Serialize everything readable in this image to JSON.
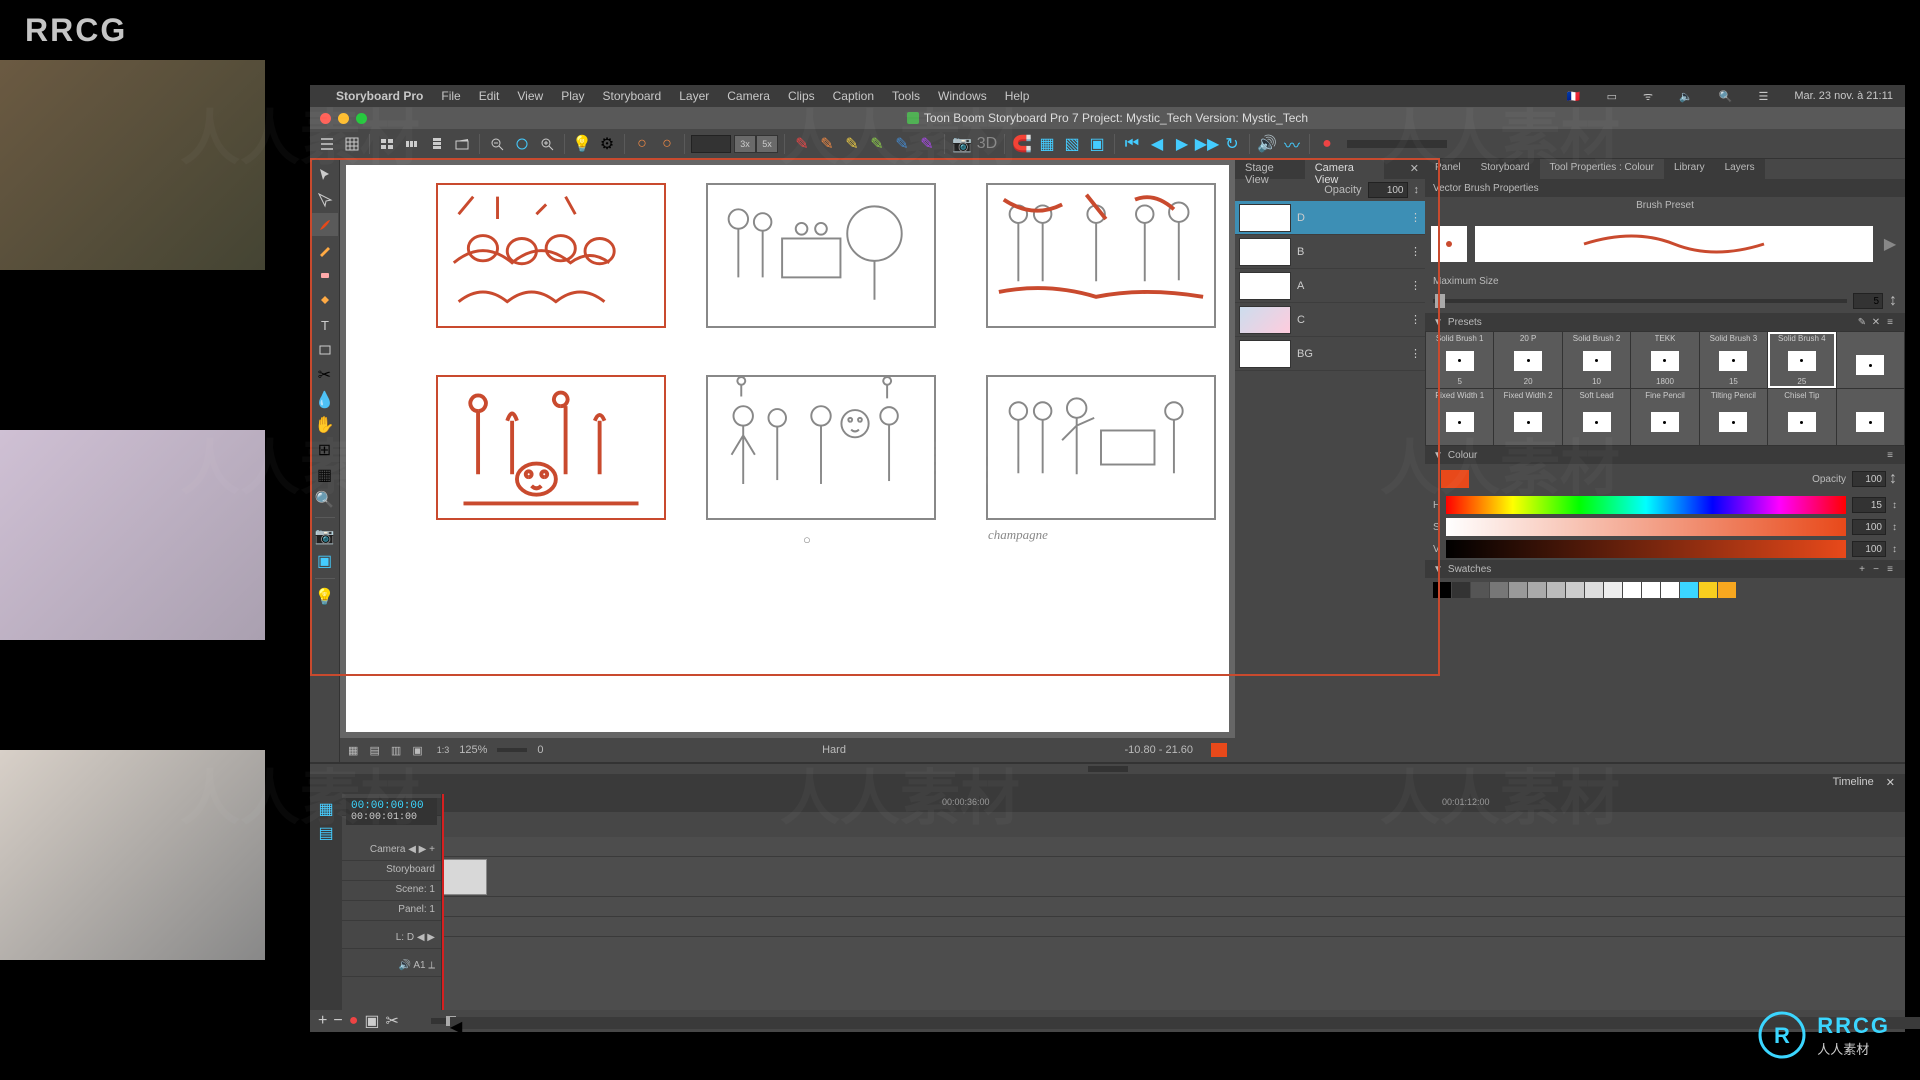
{
  "watermark_text": "RRCG",
  "menubar": {
    "apple": "",
    "app_name": "Storyboard Pro",
    "items": [
      "File",
      "Edit",
      "View",
      "Play",
      "Storyboard",
      "Layer",
      "Camera",
      "Clips",
      "Caption",
      "Tools",
      "Windows",
      "Help"
    ],
    "status_right": [
      "🇫🇷",
      "⏻",
      "⌨",
      "🔋",
      "ᯤ",
      "🔈",
      "🔍"
    ],
    "clock": "Mar. 23 nov. à 21:11"
  },
  "titlebar": {
    "title": "Toon Boom Storyboard Pro 7 Project: Mystic_Tech Version: Mystic_Tech"
  },
  "main_toolbar": {
    "zoom_3x": "3x",
    "zoom_5x": "5x"
  },
  "canvas": {
    "panel3_caption": "champagne",
    "zoom_pct": "125%",
    "zoom_offset": "0",
    "timecode_range": "-10.80 - 21.60",
    "blend_mode": "Hard"
  },
  "layers_panel": {
    "tabs": [
      "Stage View",
      "Camera View"
    ],
    "active_tab": 1,
    "opacity_label": "Opacity",
    "opacity_value": "100",
    "items": [
      {
        "name": "D",
        "active": true
      },
      {
        "name": "B",
        "active": false
      },
      {
        "name": "A",
        "active": false
      },
      {
        "name": "C",
        "active": false
      },
      {
        "name": "BG",
        "active": false
      }
    ]
  },
  "properties": {
    "tabs": [
      "Panel",
      "Storyboard",
      "Tool Properties : Colour",
      "Library",
      "Layers"
    ],
    "active_tab": 2,
    "vector_brush_label": "Vector Brush Properties",
    "brush_preset_label": "Brush Preset",
    "max_size_label": "Maximum Size",
    "max_size_value": "5",
    "presets_label": "Presets",
    "presets": [
      {
        "name": "Solid Brush 1",
        "size": "5"
      },
      {
        "name": "20 P",
        "size": "20"
      },
      {
        "name": "Solid Brush 2",
        "size": "10"
      },
      {
        "name": "TEKK",
        "size": "1800"
      },
      {
        "name": "Solid Brush 3",
        "size": "15"
      },
      {
        "name": "Solid Brush 4",
        "size": "25",
        "selected": true
      },
      {
        "name": "",
        "size": ""
      },
      {
        "name": "Fixed Width 1",
        "size": ""
      },
      {
        "name": "Fixed Width 2",
        "size": ""
      },
      {
        "name": "Soft Lead",
        "size": ""
      },
      {
        "name": "Fine Pencil",
        "size": ""
      },
      {
        "name": "Tilting Pencil",
        "size": ""
      },
      {
        "name": "Chisel Tip",
        "size": ""
      },
      {
        "name": "",
        "size": ""
      }
    ],
    "colour_label": "Colour",
    "colour_opacity_label": "Opacity",
    "colour_opacity_value": "100",
    "h_label": "H",
    "h_value": "15",
    "s_label": "S",
    "s_value": "100",
    "v_label": "V",
    "v_value": "100",
    "current_colour": "#e8491a",
    "swatches_label": "Swatches",
    "swatch_colours": [
      "#000",
      "#333",
      "#555",
      "#777",
      "#999",
      "#aaa",
      "#bbb",
      "#ccc",
      "#ddd",
      "#eee",
      "#fff",
      "#fff",
      "#fff",
      "#3bd6ff",
      "#f7ce1f",
      "#f7a71f"
    ]
  },
  "timeline": {
    "tab_label": "Timeline",
    "timecode_main": "00:00:00:00",
    "timecode_sub": "00:00:01:00",
    "ruler_marks": [
      {
        "label": "00:00:36:00",
        "pos": 500
      },
      {
        "label": "00:01:12:00",
        "pos": 1000
      }
    ],
    "track_labels": {
      "camera": "Camera",
      "storyboard": "Storyboard",
      "scene": "Scene: 1",
      "panel": "Panel: 1",
      "layer": "L: D",
      "audio": "A1"
    }
  }
}
